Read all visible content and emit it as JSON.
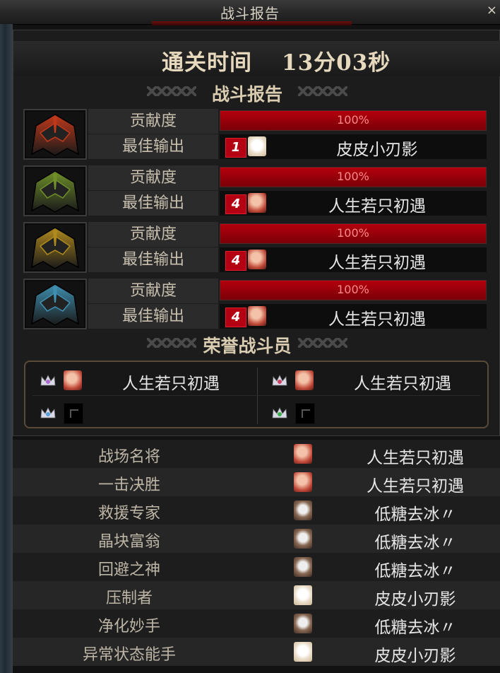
{
  "window": {
    "title": "战斗报告",
    "close_label": "×"
  },
  "clear_time": {
    "label": "通关时间",
    "value": "13分03秒"
  },
  "sections": {
    "battle_report": "战斗报告",
    "honor_fighters": "荣誉战斗员"
  },
  "dungeon_rows": [
    {
      "contribution_label": "贡献度",
      "contribution_value": "100%",
      "contribution_fraction": 1.0,
      "best_output_label": "最佳输出",
      "badge": "1",
      "player": "皮皮小刃影",
      "avatar": "white-haired-avatar-icon",
      "helm_color": "#c0391b"
    },
    {
      "contribution_label": "贡献度",
      "contribution_value": "100%",
      "contribution_fraction": 1.0,
      "best_output_label": "最佳输出",
      "badge": "4",
      "player": "人生若只初遇",
      "avatar": "red-haired-avatar-icon",
      "helm_color": "#6f8f2a"
    },
    {
      "contribution_label": "贡献度",
      "contribution_value": "100%",
      "contribution_fraction": 1.0,
      "best_output_label": "最佳输出",
      "badge": "4",
      "player": "人生若只初遇",
      "avatar": "red-haired-avatar-icon",
      "helm_color": "#b08a1e"
    },
    {
      "contribution_label": "贡献度",
      "contribution_value": "100%",
      "contribution_fraction": 1.0,
      "best_output_label": "最佳输出",
      "badge": "4",
      "player": "人生若只初遇",
      "avatar": "red-haired-avatar-icon",
      "helm_color": "#3f8fb0"
    }
  ],
  "honor": [
    {
      "name": "人生若只初遇",
      "crown_color": "#b06ad0"
    },
    {
      "name": "人生若只初遇",
      "crown_color": "#d04060"
    },
    {
      "name": "",
      "crown_color": "#5aa0d8"
    },
    {
      "name": "",
      "crown_color": "#3bb04a"
    }
  ],
  "awards": [
    {
      "title": "战场名将",
      "player": "人生若只初遇",
      "avatar": "red-haired-avatar-icon"
    },
    {
      "title": "一击决胜",
      "player": "人生若只初遇",
      "avatar": "red-haired-avatar-icon"
    },
    {
      "title": "救援专家",
      "player": "低糖去冰〃",
      "avatar": "dark-skinned-avatar-icon"
    },
    {
      "title": "晶块富翁",
      "player": "低糖去冰〃",
      "avatar": "dark-skinned-avatar-icon"
    },
    {
      "title": "回避之神",
      "player": "低糖去冰〃",
      "avatar": "dark-skinned-avatar-icon"
    },
    {
      "title": "压制者",
      "player": "皮皮小刃影",
      "avatar": "white-haired-avatar-icon"
    },
    {
      "title": "净化妙手",
      "player": "低糖去冰〃",
      "avatar": "dark-skinned-avatar-icon"
    },
    {
      "title": "异常状态能手",
      "player": "皮皮小刃影",
      "avatar": "white-haired-avatar-icon"
    }
  ]
}
